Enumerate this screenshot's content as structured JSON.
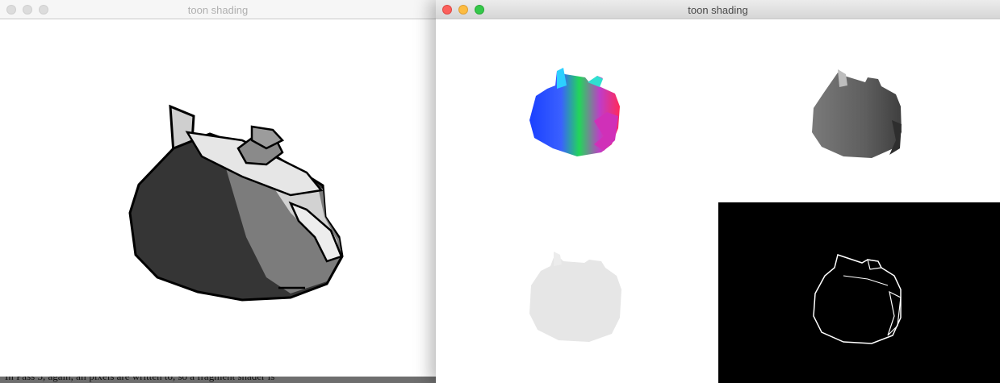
{
  "left_window": {
    "title": "toon shading",
    "viewport": "toon-shaded-teapot"
  },
  "right_window": {
    "title": "toon shading",
    "panels": [
      {
        "name": "normal-buffer-panel"
      },
      {
        "name": "depth-buffer-panel"
      },
      {
        "name": "mask-buffer-panel"
      },
      {
        "name": "edge-buffer-panel"
      }
    ]
  },
  "background_document": {
    "text": "In Pass 3, again, all pixels are written to, so a fragment shader is"
  }
}
